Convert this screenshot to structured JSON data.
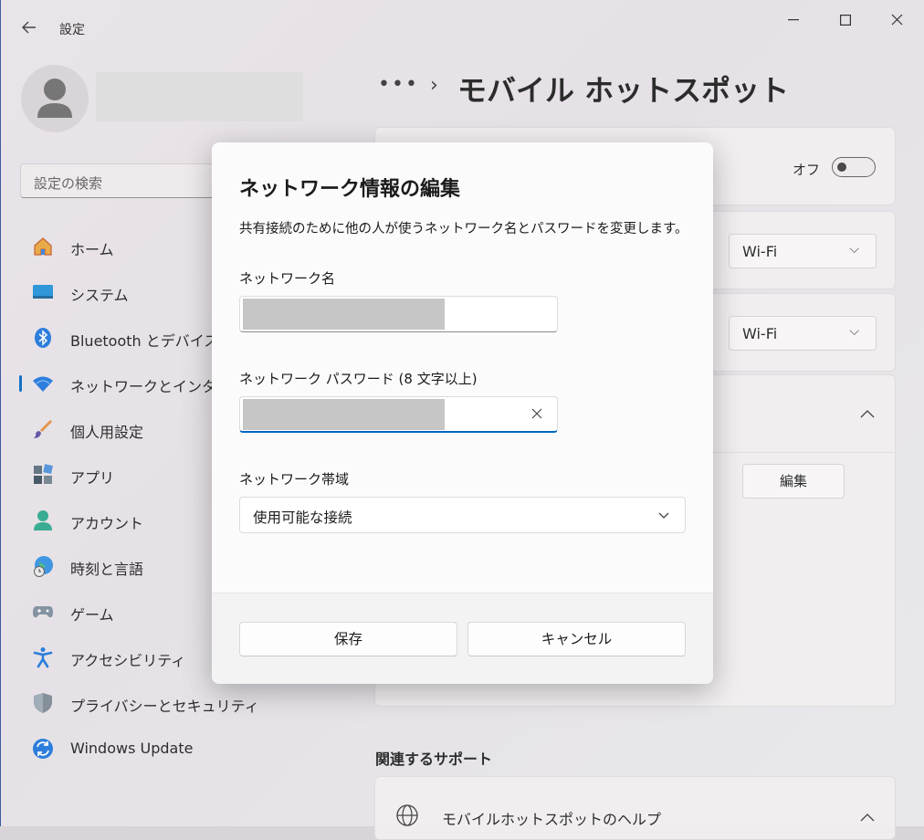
{
  "window": {
    "title": "設定",
    "back_icon": "arrow-left-icon",
    "controls": [
      "minimize-icon",
      "maximize-icon",
      "close-icon"
    ]
  },
  "sidebar": {
    "search_placeholder": "設定の検索",
    "items": [
      {
        "label": "ホーム",
        "icon": "home-icon"
      },
      {
        "label": "システム",
        "icon": "monitor-icon"
      },
      {
        "label": "Bluetooth とデバイス",
        "icon": "bluetooth-icon"
      },
      {
        "label": "ネットワークとインターネ",
        "icon": "wifi-icon",
        "active": true
      },
      {
        "label": "個人用設定",
        "icon": "brush-icon"
      },
      {
        "label": "アプリ",
        "icon": "apps-icon"
      },
      {
        "label": "アカウント",
        "icon": "person-icon"
      },
      {
        "label": "時刻と言語",
        "icon": "globe-clock-icon"
      },
      {
        "label": "ゲーム",
        "icon": "gamepad-icon"
      },
      {
        "label": "アクセシビリティ",
        "icon": "accessibility-icon"
      },
      {
        "label": "プライバシーとセキュリティ",
        "icon": "shield-icon"
      },
      {
        "label": "Windows Update",
        "icon": "update-icon"
      }
    ]
  },
  "main": {
    "breadcrumb_dots": "•••",
    "breadcrumb_chevron": "›",
    "page_title": "モバイル ホットスポット",
    "toggle_label": "オフ",
    "select1_value": "Wi-Fi",
    "select2_value": "Wi-Fi",
    "edit_label": "編集",
    "related_heading": "関連するサポート",
    "help_label": "モバイルホットスポットのヘルプ"
  },
  "dialog": {
    "title": "ネットワーク情報の編集",
    "description": "共有接続のために他の人が使うネットワーク名とパスワードを変更します。",
    "name_label": "ネットワーク名",
    "password_label": "ネットワーク パスワード (8 文字以上)",
    "band_label": "ネットワーク帯域",
    "band_value": "使用可能な接続",
    "save_label": "保存",
    "cancel_label": "キャンセル"
  },
  "colors": {
    "accent": "#0067c0",
    "dialog_bg": "#fbfbfb",
    "footer_bg": "#f3f3f3"
  }
}
